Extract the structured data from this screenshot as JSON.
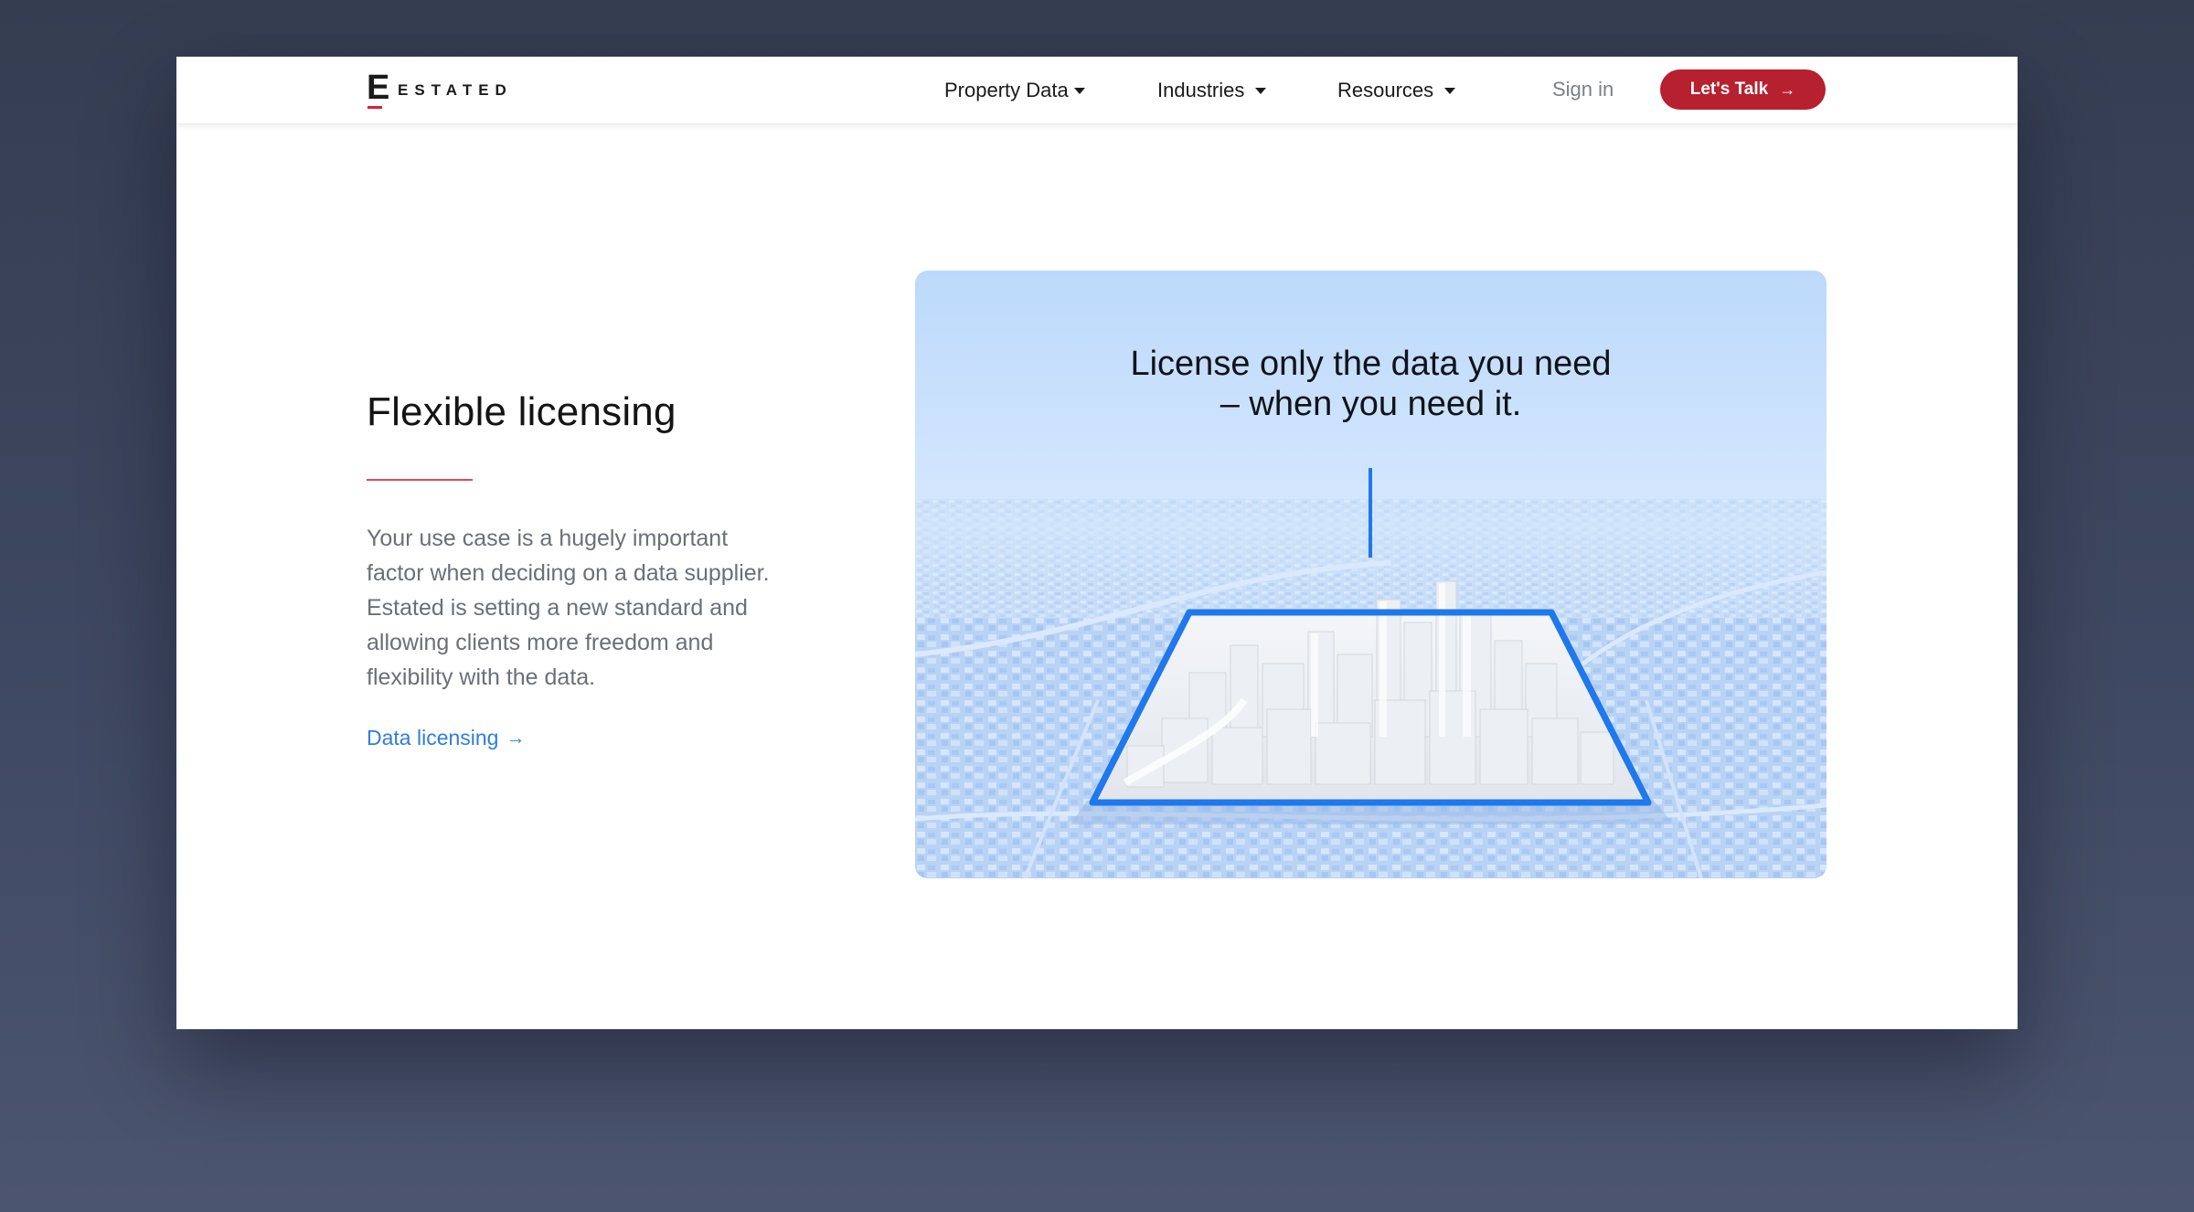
{
  "brand": {
    "logo_letter": "E",
    "logo_word": "ESTATED",
    "accent_color": "#b7202f",
    "link_color": "#2f7de0"
  },
  "nav": {
    "items": [
      {
        "label": "Property Data"
      },
      {
        "label": "Industries"
      },
      {
        "label": "Resources"
      }
    ],
    "signin_label": "Sign in",
    "cta_label": "Let's Talk",
    "cta_icon": "arrow-right-icon"
  },
  "section": {
    "heading": "Flexible licensing",
    "paragraph": "Your use case is a hugely important factor when deciding on a data supplier. Estated is setting a new standard and allowing clients more freedom and flexibility with the data.",
    "link_label": "Data licensing",
    "link_icon": "arrow-right-icon"
  },
  "hero": {
    "title_line1": "License only the data you need",
    "title_line2": "– when you need it."
  }
}
